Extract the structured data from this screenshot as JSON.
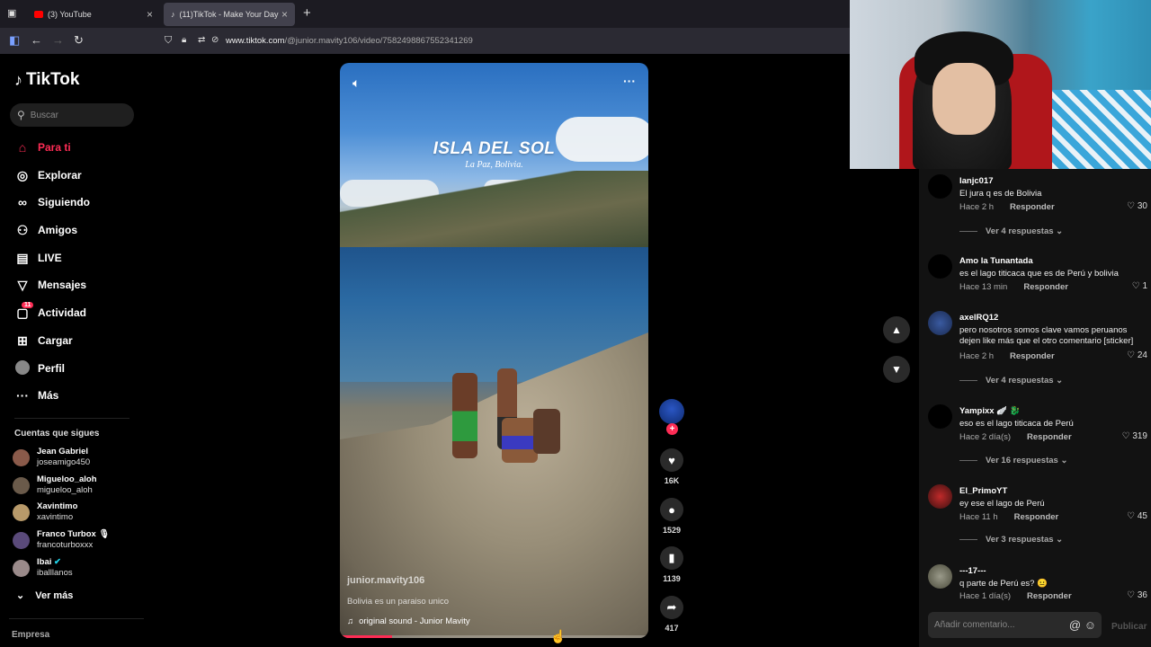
{
  "browser": {
    "tabs": [
      {
        "label": "(3) YouTube",
        "favicon_color": "#ff0000"
      },
      {
        "label": "(11)TikTok - Make Your Day",
        "favicon_color": "#ffffff"
      }
    ],
    "url_domain": "www.tiktok.com",
    "url_path": "/@junior.mavity106/video/7582498867552341269"
  },
  "sidebar": {
    "logo": "TikTok",
    "search_placeholder": "Buscar",
    "nav": [
      {
        "label": "Para ti",
        "icon": "home-icon",
        "active": true
      },
      {
        "label": "Explorar",
        "icon": "compass-icon"
      },
      {
        "label": "Siguiendo",
        "icon": "following-icon"
      },
      {
        "label": "Amigos",
        "icon": "friends-icon"
      },
      {
        "label": "LIVE",
        "icon": "live-icon"
      },
      {
        "label": "Mensajes",
        "icon": "messages-icon"
      },
      {
        "label": "Actividad",
        "icon": "activity-icon",
        "badge": "11"
      },
      {
        "label": "Cargar",
        "icon": "upload-icon"
      },
      {
        "label": "Perfil",
        "icon": "profile-icon"
      },
      {
        "label": "Más",
        "icon": "more-icon"
      }
    ],
    "following_title": "Cuentas que sigues",
    "following": [
      {
        "name": "Jean Gabriel",
        "handle": "joseamigo450"
      },
      {
        "name": "Migueloo_aloh",
        "handle": "migueloo_aloh"
      },
      {
        "name": "Xavintimo",
        "handle": "xavintimo"
      },
      {
        "name": "Franco Turbox 🎙",
        "handle": "francoturboxxx"
      },
      {
        "name": "Ibai",
        "handle": "iballlanos"
      }
    ],
    "see_more": "Ver más",
    "footer": "Empresa"
  },
  "video": {
    "title": "ISLA DEL SOL",
    "subtitle": "La Paz, Bolivia.",
    "author": "junior.mavity106",
    "caption": "Bolivia es un paraiso unico",
    "sound": "original sound - Junior Mavity",
    "progress": 0.17
  },
  "actions": {
    "likes": "16K",
    "comments": "1529",
    "saves": "1139",
    "shares": "417"
  },
  "comments": [
    {
      "user": "Ianjc017",
      "text": "El jura q es de Bolivia",
      "time": "Hace 2 h",
      "likes": "30",
      "replies": "Ver 4 respuestas"
    },
    {
      "user": "Amo la Tunantada",
      "text": "es el lago titicaca que es de Perú y bolivia",
      "time": "Hace 13 min",
      "likes": "1"
    },
    {
      "user": "axelRQ12",
      "text": "pero nosotros somos clave vamos peruanos dejen like más que el otro comentario [sticker]",
      "time": "Hace 2 h",
      "likes": "24",
      "replies": "Ver 4 respuestas"
    },
    {
      "user": "Yampixx 🪽 🐉",
      "text": "eso es el lago titicaca de Perú",
      "time": "Hace 2 día(s)",
      "likes": "319",
      "replies": "Ver 16 respuestas"
    },
    {
      "user": "El_PrimoYT",
      "text": "ey ese el lago de Perú",
      "time": "Hace 11 h",
      "likes": "45",
      "replies": "Ver 3 respuestas"
    },
    {
      "user": "---17---",
      "text": "q parte de Perú es? 😐",
      "time": "Hace 1 día(s)",
      "likes": "36"
    }
  ],
  "reply_label": "Responder",
  "add_comment_placeholder": "Añadir comentario...",
  "publish_label": "Publicar"
}
